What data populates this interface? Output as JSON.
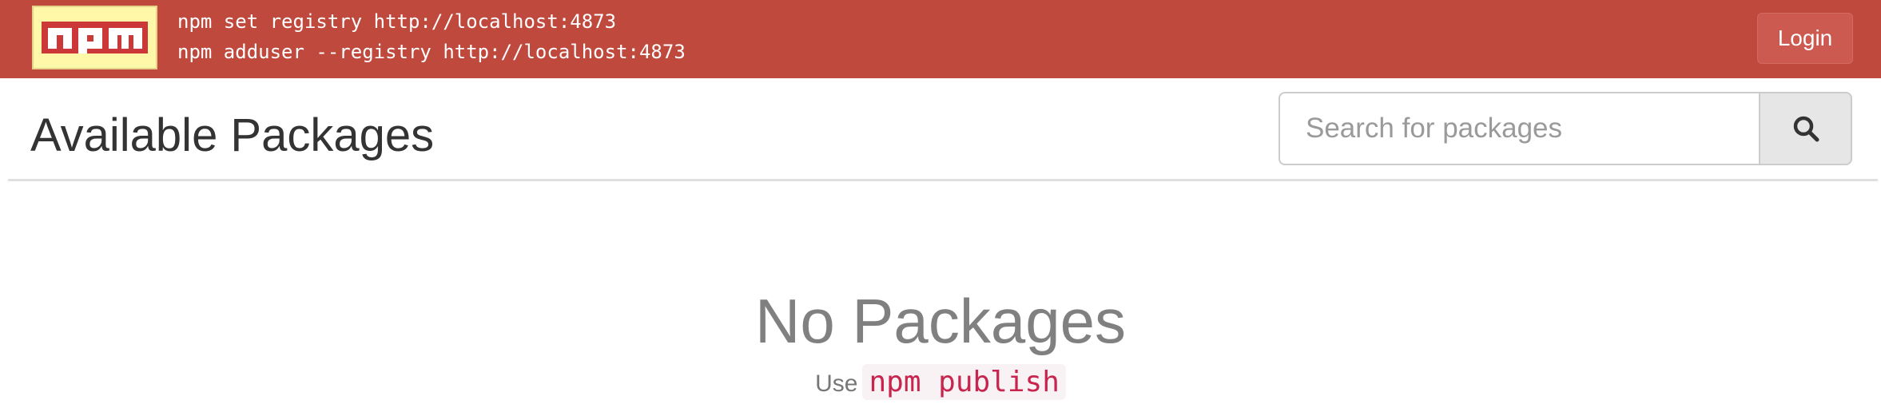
{
  "header": {
    "logo_text": "npm",
    "setup_lines": [
      "npm set registry http://localhost:4873",
      "npm adduser --registry http://localhost:4873"
    ],
    "login_label": "Login",
    "colors": {
      "bar": "#c0493e",
      "logo_bg": "#fff8a8",
      "logo_red": "#cb3837"
    }
  },
  "main": {
    "title": "Available Packages",
    "search": {
      "placeholder": "Search for packages",
      "value": "",
      "icon": "search-icon"
    },
    "empty_state": {
      "title": "No Packages",
      "hint_prefix": "Use",
      "hint_code": "npm publish"
    }
  }
}
